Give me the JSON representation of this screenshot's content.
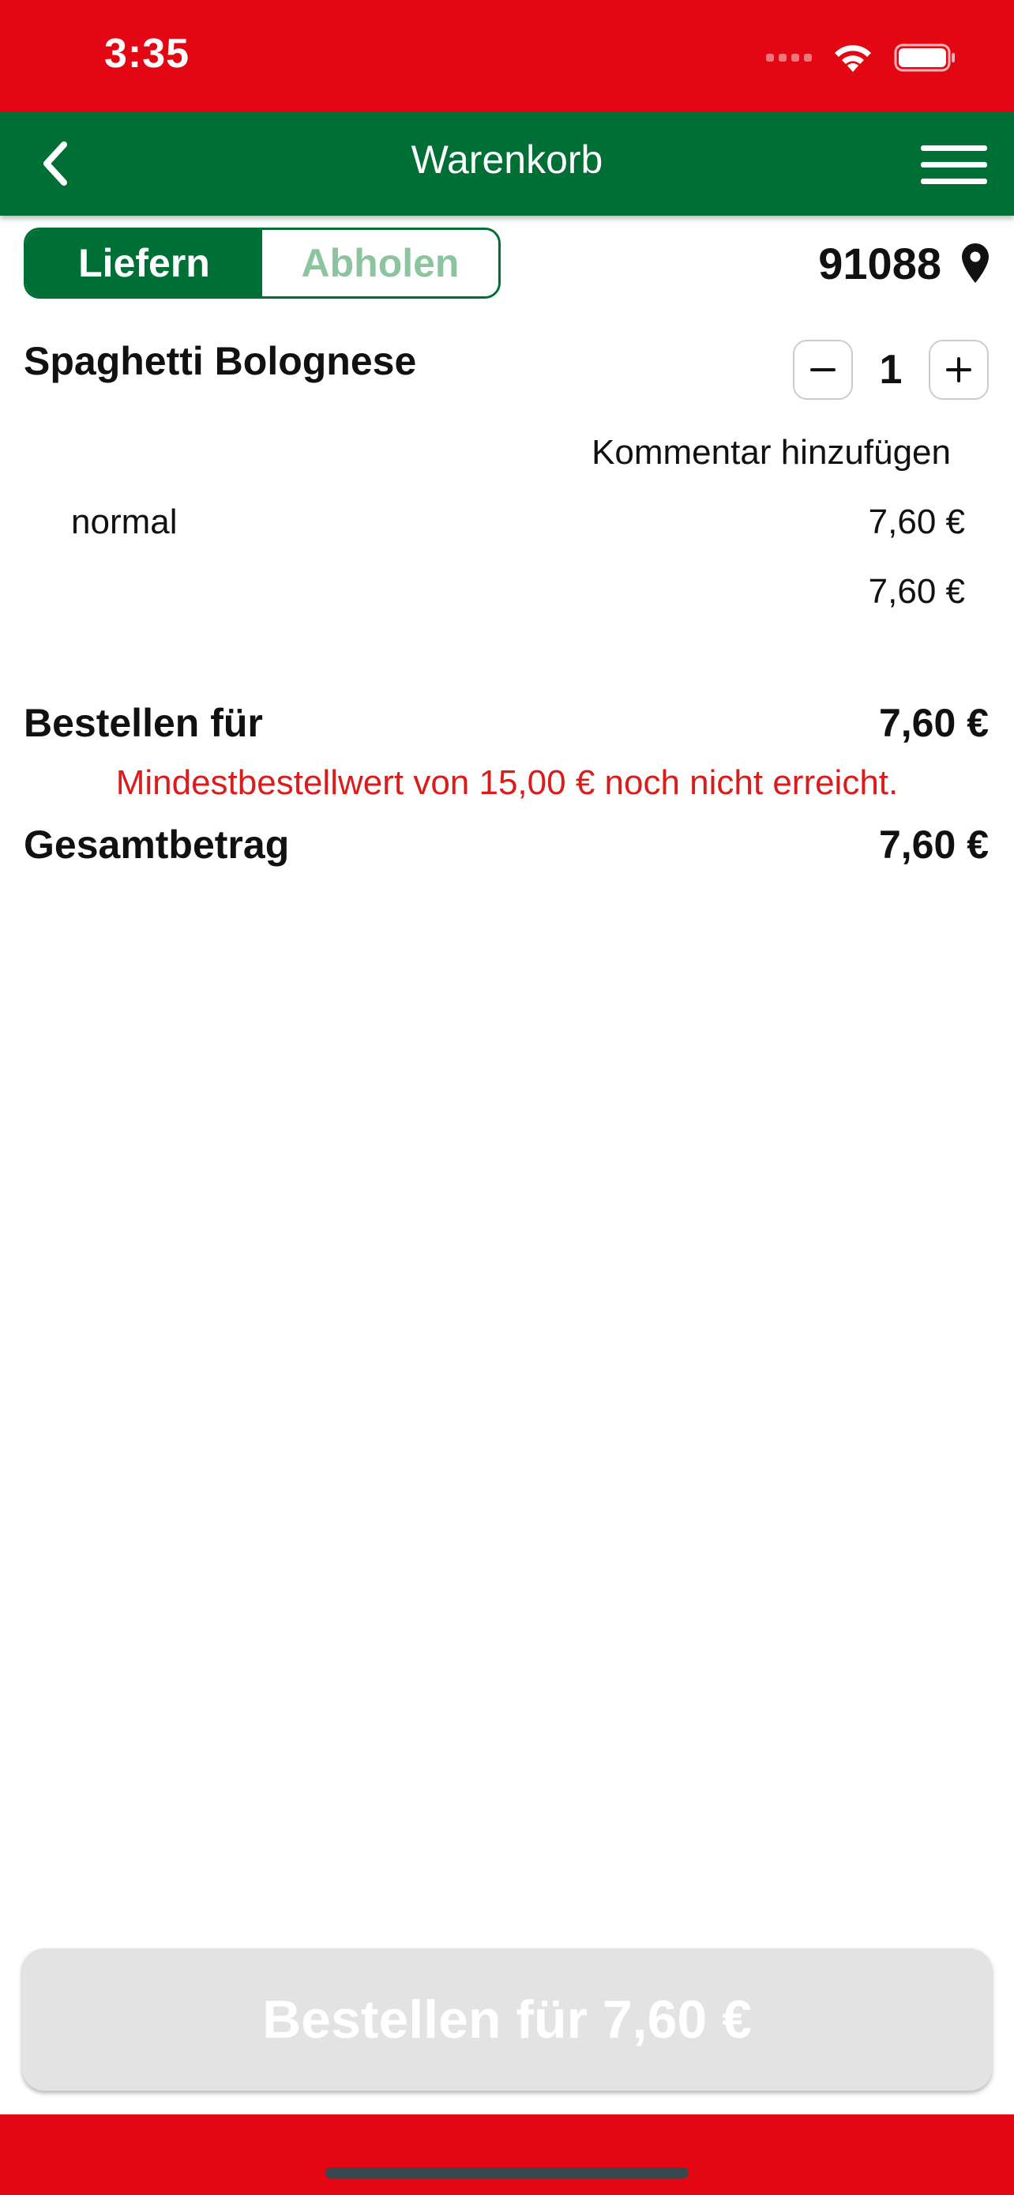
{
  "status_bar": {
    "time": "3:35",
    "bg_color": "#e30613",
    "icons": [
      "signal-icon",
      "wifi-icon",
      "battery-icon"
    ]
  },
  "nav": {
    "title": "Warenkorb",
    "bg_color": "#006f35",
    "back_icon": "chevron-left-icon",
    "menu_icon": "hamburger-menu-icon"
  },
  "mode_toggle": {
    "options": [
      {
        "label": "Liefern",
        "active": true
      },
      {
        "label": "Abholen",
        "active": false
      }
    ]
  },
  "location": {
    "zip": "91088",
    "icon": "map-pin-icon"
  },
  "cart_item": {
    "name": "Spaghetti Bolognese",
    "quantity": "1",
    "comment_link": "Kommentar hinzufügen",
    "option_label": "normal",
    "option_price": "7,60 €",
    "subtotal": "7,60 €"
  },
  "summary": {
    "order_label": "Bestellen für",
    "order_value": "7,60 €",
    "min_warning": "Mindestbestellwert von 15,00 € noch nicht erreicht.",
    "total_label": "Gesamtbetrag",
    "total_value": "7,60 €"
  },
  "order_button": {
    "label": "Bestellen für 7,60 €",
    "disabled": true
  },
  "colors": {
    "brand_red": "#e30613",
    "brand_green": "#006f35",
    "warning_red": "#d91c1c"
  }
}
